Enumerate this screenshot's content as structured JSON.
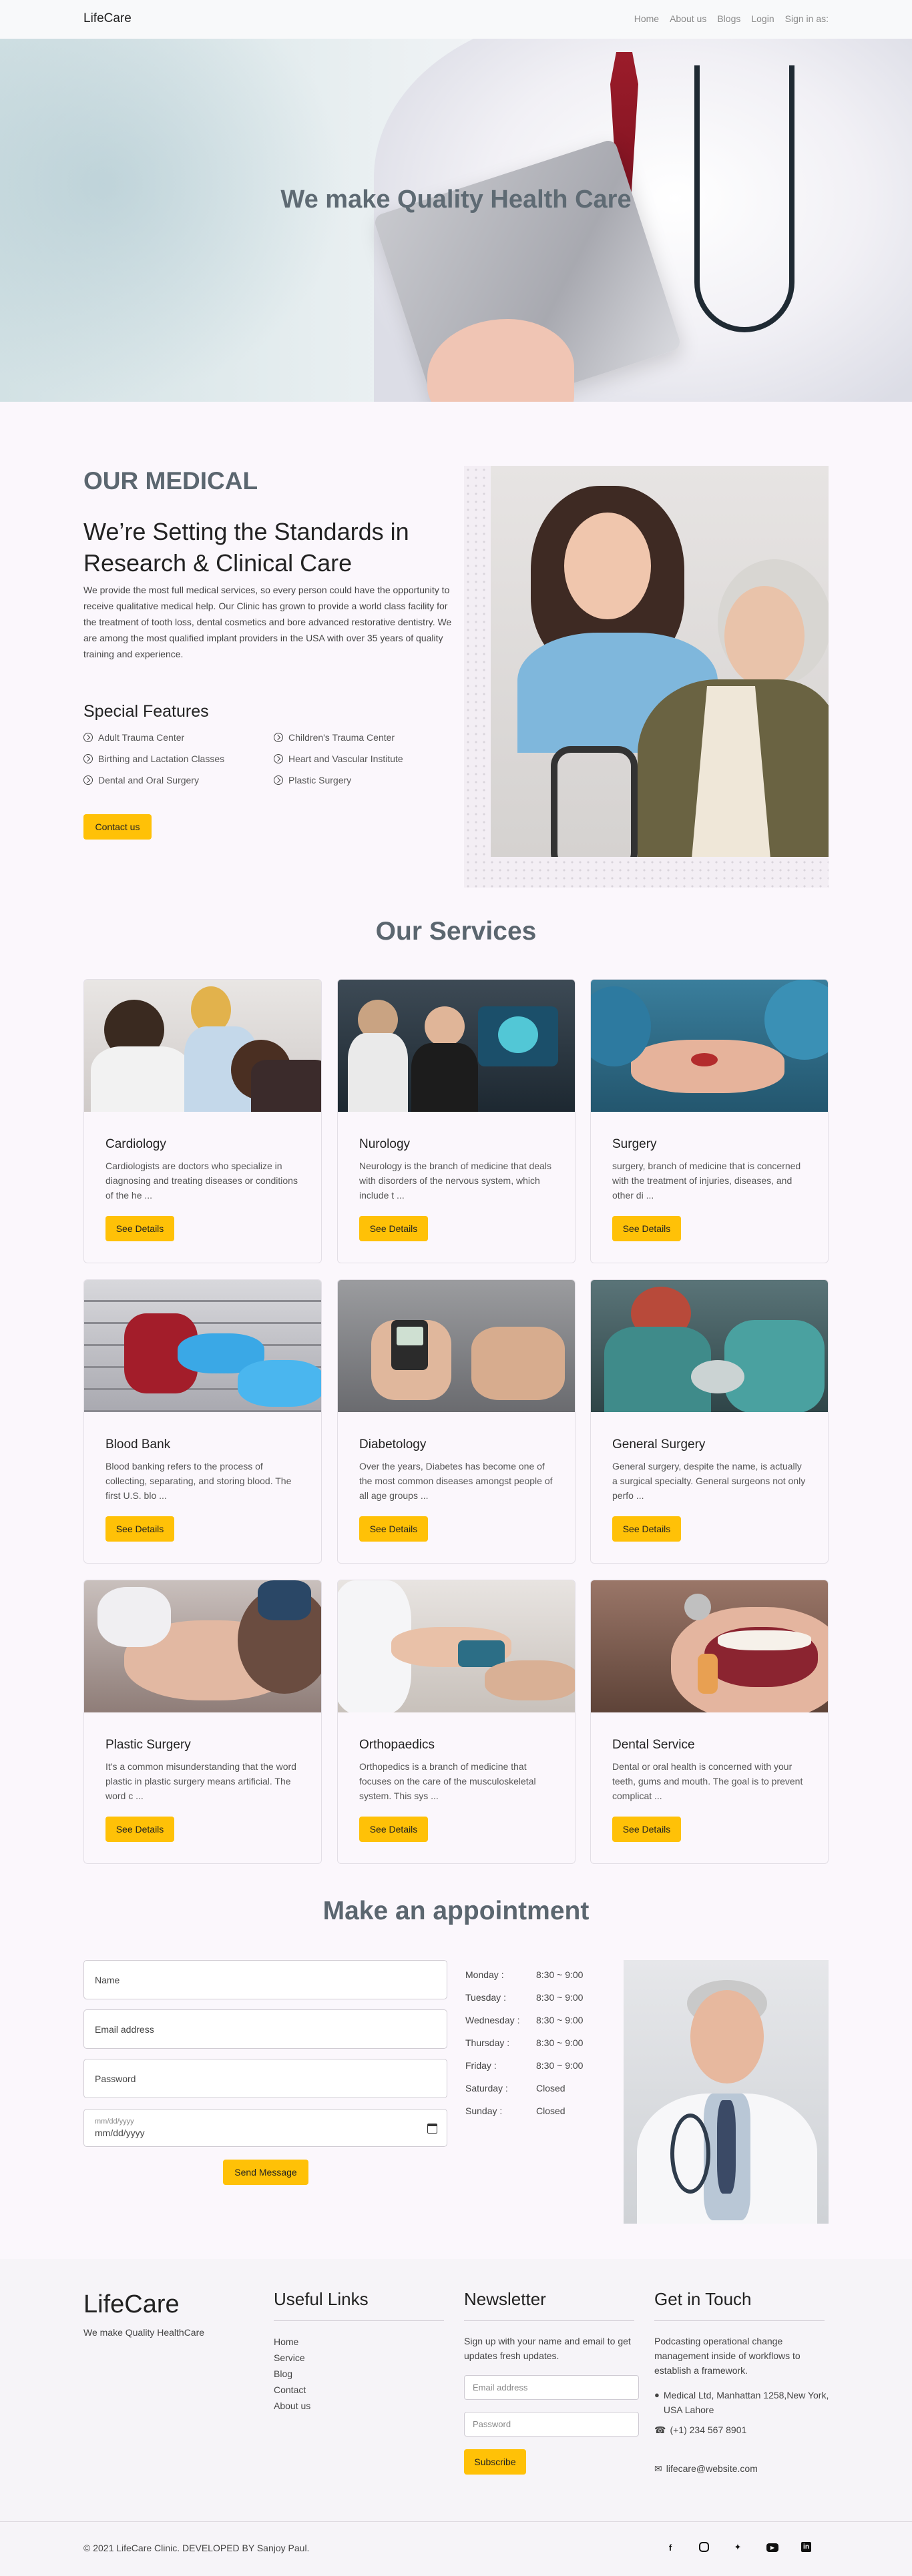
{
  "nav": {
    "brand": "LifeCare",
    "links": [
      "Home",
      "About us",
      "Blogs",
      "Login",
      "Sign in as:"
    ]
  },
  "hero": {
    "title": "We make Quality Health Care"
  },
  "about": {
    "heading": "OUR MEDICAL",
    "subheading": "We’re Setting the Standards in Research & Clinical Care",
    "paragraph": "We provide the most full medical services, so every person could have the opportunity to receive qualitative medical help. Our Clinic has grown to provide a world class facility for the treatment of tooth loss, dental cosmetics and bore advanced restorative dentistry. We are among the most qualified implant providers in the USA with over 35 years of quality training and experience.",
    "features_title": "Special Features",
    "features": [
      "Adult Trauma Center",
      "Children's Trauma Center",
      "Birthing and Lactation Classes",
      "Heart and Vascular Institute",
      "Dental and Oral Surgery",
      "Plastic Surgery"
    ],
    "button": "Contact us"
  },
  "services": {
    "title": "Our Services",
    "button": "See Details",
    "items": [
      {
        "title": "Cardiology",
        "desc": "Cardiologists are doctors who specialize in diagnosing and treating diseases or conditions of the he ..."
      },
      {
        "title": "Nurology",
        "desc": "Neurology is the branch of medicine that deals with disorders of the nervous system, which include t ..."
      },
      {
        "title": "Surgery",
        "desc": "surgery, branch of medicine that is concerned with the treatment of injuries, diseases, and other di ..."
      },
      {
        "title": "Blood Bank",
        "desc": "Blood banking refers to the process of collecting, separating, and storing blood. The first U.S. blo ..."
      },
      {
        "title": "Diabetology",
        "desc": "Over the years, Diabetes has become one of the most common diseases amongst people of all age groups ..."
      },
      {
        "title": "General Surgery",
        "desc": "General surgery, despite the name, is actually a surgical specialty. General surgeons not only perfo ..."
      },
      {
        "title": "Plastic Surgery",
        "desc": "It's a common misunderstanding that the word plastic in plastic surgery means artificial. The word c ..."
      },
      {
        "title": "Orthopaedics",
        "desc": "Orthopedics is a branch of medicine that focuses on the care of the musculoskeletal system. This sys ..."
      },
      {
        "title": "Dental Service",
        "desc": "Dental or oral health is concerned with your teeth, gums and mouth. The goal is to prevent complicat ..."
      }
    ]
  },
  "appointment": {
    "title": "Make an appointment",
    "name_placeholder": "Name",
    "email_placeholder": "Email address",
    "password_placeholder": "Password",
    "date_placeholder": "mm/dd/yyyy",
    "date_value": "mm/dd/yyyy",
    "button": "Send Message",
    "hours": [
      {
        "day": "Monday :",
        "time": "8:30 ~ 9:00"
      },
      {
        "day": "Tuesday :",
        "time": "8:30 ~ 9:00"
      },
      {
        "day": "Wednesday :",
        "time": "8:30 ~ 9:00"
      },
      {
        "day": "Thursday :",
        "time": "8:30 ~ 9:00"
      },
      {
        "day": "Friday :",
        "time": "8:30 ~ 9:00"
      },
      {
        "day": "Saturday :",
        "time": "Closed"
      },
      {
        "day": "Sunday :",
        "time": "Closed"
      }
    ]
  },
  "footer": {
    "brand": "LifeCare",
    "tagline": "We make Quality HealthCare",
    "links_title": "Useful Links",
    "links": [
      "Home",
      "Service",
      "Blog",
      "Contact",
      "About us"
    ],
    "newsletter_title": "Newsletter",
    "newsletter_text": "Sign up with your name and email to get updates fresh updates.",
    "email_placeholder": "Email address",
    "password_placeholder": "Password",
    "subscribe": "Subscribe",
    "contact_title": "Get in Touch",
    "contact_text": "Podcasting operational change management inside of workflows to establish a framework.",
    "address": "Medical Ltd, Manhattan 1258,New York, USA Lahore",
    "phone": "(+1) 234 567 8901",
    "email": "lifecare@website.com",
    "copyright": "© 2021 LifeCare Clinic. DEVELOPED BY Sanjoy Paul."
  },
  "colors": {
    "accent": "#ffc107",
    "heading": "#5b666f",
    "page_bg": "#fbf7fc"
  }
}
